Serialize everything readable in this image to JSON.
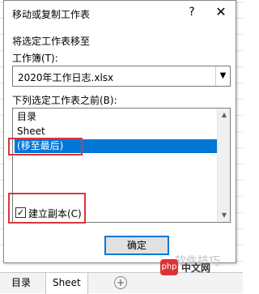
{
  "dialog": {
    "title": "移动或复制工作表",
    "help_icon": "?",
    "close_icon": "✕",
    "move_label": "将选定工作表移至",
    "workbook_label": "工作簿(T):",
    "workbook_value": "2020年工作日志.xlsx",
    "before_label": "下列选定工作表之前(B):",
    "sheet_list": [
      "目录",
      "Sheet",
      "(移至最后)"
    ],
    "selected_index": 2,
    "create_copy_label": "建立副本(C)",
    "create_copy_checked": true,
    "checkmark": "✓",
    "ok_label": "确定"
  },
  "sheet_tabs": {
    "tabs": [
      "目录",
      "Sheet"
    ],
    "add_icon": "+"
  },
  "watermark": {
    "text": "软件技巧",
    "logo": "php",
    "site": "中文网"
  },
  "colors": {
    "selection": "#0078d7",
    "highlight_box": "#d9363e"
  }
}
